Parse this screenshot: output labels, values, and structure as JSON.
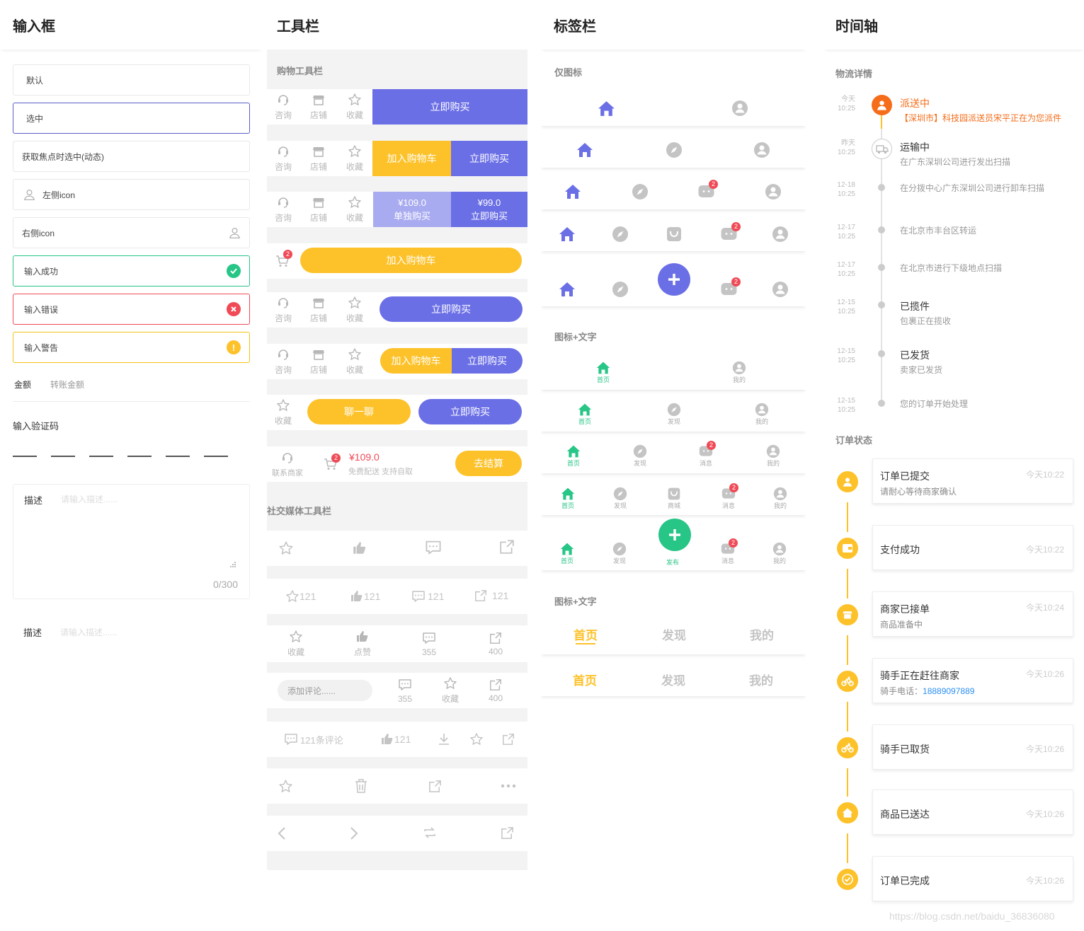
{
  "colors": {
    "primary": "#6b6fe6",
    "primary_light": "#a9abf0",
    "yellow": "#fdc22a",
    "green": "#27c586",
    "red": "#f04a56",
    "orange": "#f56d1a",
    "gray_icon": "#c4c4c4"
  },
  "input": {
    "title": "输入框",
    "default": "默认",
    "selected": "选中",
    "focus": "获取焦点时选中(动态)",
    "left_icon": "左侧icon",
    "right_icon": "右侧icon",
    "success": "输入成功",
    "error": "输入错误",
    "warning": "输入警告",
    "amount_label": "金额",
    "amount_placeholder": "转账金额",
    "verify_label": "输入验证码",
    "verify_slots": 6,
    "desc_label": "描述",
    "desc_placeholder": "请输入描述......",
    "desc_count": "0/300",
    "desc2_label": "描述",
    "desc2_placeholder": "请输入描述......"
  },
  "toolbar": {
    "title": "工具栏",
    "shop_section": "购物工具栏",
    "consult": "咨询",
    "store": "店铺",
    "collect": "收藏",
    "buy_now": "立即购买",
    "add_cart": "加入购物车",
    "price_single": "¥109.0",
    "buy_single": "单独购买",
    "price_group": "¥99.0",
    "buy_group": "立即购买",
    "cart_badge": "2",
    "chat": "聊一聊",
    "contact_merchant": "联系商家",
    "total": "¥109.0",
    "delivery": "免费配送 支持自取",
    "checkout": "去结算",
    "social_section": "社交媒体工具栏",
    "count_star": "121",
    "count_like": "121",
    "count_comment": "121",
    "count_share": "121",
    "like": "点赞",
    "comment_count": "355",
    "share_count": "400",
    "comment_placeholder": "添加评论......",
    "comments_label": "121条评论",
    "like_count2": "121"
  },
  "tabbar": {
    "title": "标签栏",
    "icon_only": "仅图标",
    "icon_text": "图标+文字",
    "icon_text2": "图标+文字",
    "home": "首页",
    "discover": "发现",
    "mall": "商城",
    "message": "消息",
    "mine": "我的",
    "publish": "发布",
    "badge": "2",
    "t_home": "首页",
    "t_discover": "发现",
    "t_mine": "我的"
  },
  "timeline": {
    "title": "时间轴",
    "logistics_section": "物流详情",
    "logistics": [
      {
        "date": "今天",
        "time": "10:25",
        "title": "派送中",
        "desc": "【深圳市】科技园派送员宋平正在为您派件"
      },
      {
        "date": "昨天",
        "time": "10:25",
        "title": "运输中",
        "desc": "在广东深圳公司进行发出扫描"
      },
      {
        "date": "12-18",
        "time": "10:25",
        "title": "",
        "desc": "在分拨中心广东深圳公司进行卸车扫描"
      },
      {
        "date": "12-17",
        "time": "10:25",
        "title": "",
        "desc": "在北京市丰台区转运"
      },
      {
        "date": "12-17",
        "time": "10:25",
        "title": "",
        "desc": "在北京市进行下级地点扫描"
      },
      {
        "date": "12-15",
        "time": "10:25",
        "title": "已揽件",
        "desc": "包裹正在揽收"
      },
      {
        "date": "12-15",
        "time": "10:25",
        "title": "已发货",
        "desc": "卖家已发货"
      },
      {
        "date": "12-15",
        "time": "10:25",
        "title": "",
        "desc": "您的订单开始处理"
      }
    ],
    "order_section": "订单状态",
    "orders": [
      {
        "title": "订单已提交",
        "time": "今天10:22",
        "desc": "请耐心等待商家确认",
        "icon": "user-icon"
      },
      {
        "title": "支付成功",
        "time": "今天10:22",
        "desc": "",
        "icon": "wallet-icon"
      },
      {
        "title": "商家已接单",
        "time": "今天10:24",
        "desc": "商品准备中",
        "icon": "store-icon"
      },
      {
        "title": "骑手正在赶往商家",
        "time": "今天10:26",
        "desc": "骑手电话：",
        "phone": "18889097889",
        "icon": "bike-icon"
      },
      {
        "title": "骑手已取货",
        "time": "今天10:26",
        "desc": "",
        "icon": "bike-icon"
      },
      {
        "title": "商品已送达",
        "time": "今天10:26",
        "desc": "",
        "icon": "home-icon"
      },
      {
        "title": "订单已完成",
        "time": "今天10:26",
        "desc": "",
        "icon": "check-icon"
      }
    ]
  },
  "watermark": "https://blog.csdn.net/baidu_36836080"
}
